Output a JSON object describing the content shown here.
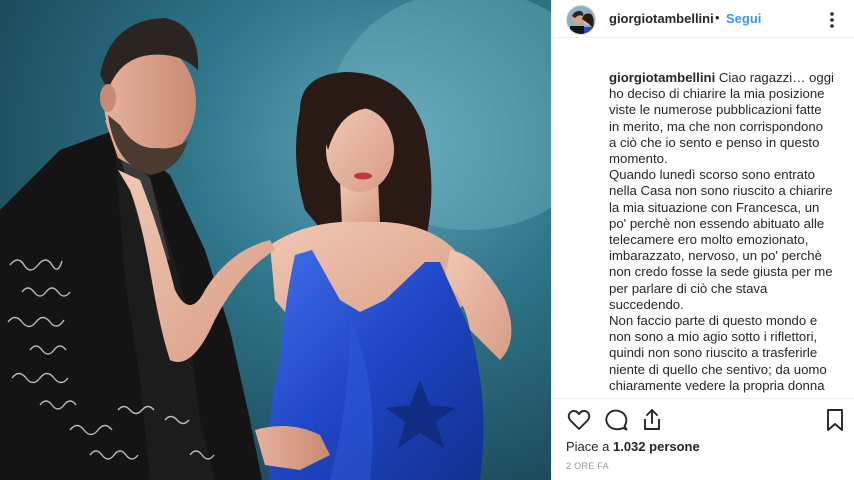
{
  "header": {
    "username": "giorgiotambellini",
    "separator": "•",
    "follow_label": "Segui",
    "more_icon": "more-options-icon"
  },
  "caption": {
    "username": "giorgiotambellini",
    "lines": [
      "Ciao ragazzi… oggi",
      "ho deciso di chiarire la mia posizione",
      "viste le numerose pubblicazioni fatte",
      "in merito, ma che non corrispondono",
      "a ciò che io sento e penso in questo",
      "momento.",
      "Quando lunedì scorso sono entrato",
      "nella Casa non sono riuscito a chiarire",
      "la mia situazione con Francesca, un",
      "po' perchè non essendo abituato alle",
      "telecamere ero molto emozionato,",
      "imbarazzato, nervoso, un po' perchè",
      "non credo fosse la sede giusta per me",
      "per parlare di ciò che stava",
      "succedendo.",
      "Non faccio parte di questo mondo e",
      "non sono a mio agio sotto i riflettori,",
      "quindi non sono riuscito a trasferirle",
      "niente di quello che sentivo; da uomo",
      "chiaramente vedere la propria donna"
    ]
  },
  "actions": {
    "like_icon": "heart-icon",
    "comment_icon": "comment-icon",
    "share_icon": "share-icon",
    "save_icon": "bookmark-icon",
    "likes_prefix": "Piace a ",
    "likes_count": "1.032",
    "likes_suffix": " persone",
    "time": "2 ORE FA"
  },
  "colors": {
    "link_blue": "#3897f0",
    "text": "#262626",
    "muted": "#999999",
    "photo_bg": "#2e7488",
    "dress_blue": "#1f49c9"
  }
}
